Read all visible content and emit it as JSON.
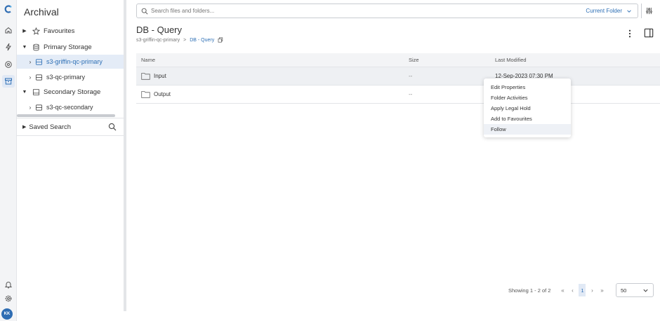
{
  "sidebar_icons": [
    "logo-icon",
    "home-icon",
    "activity-icon",
    "gauge-icon",
    "archive-icon",
    "bell-icon",
    "gear-icon"
  ],
  "user": {
    "initials": "KK"
  },
  "tree": {
    "title": "Archival",
    "favourites": "Favourites",
    "primary_storage": "Primary Storage",
    "primary_items": [
      "s3-griffin-qc-primary",
      "s3-qc-primary"
    ],
    "secondary_storage": "Secondary Storage",
    "secondary_items": [
      "s3-qc-secondary"
    ],
    "saved_search": "Saved Search"
  },
  "search": {
    "placeholder": "Search files and folders...",
    "scope": "Current Folder"
  },
  "page": {
    "title": "DB - Query",
    "breadcrumb": [
      "s3-griffin-qc-primary",
      ">",
      "DB - Query"
    ]
  },
  "table": {
    "headers": {
      "name": "Name",
      "size": "Size",
      "modified": "Last Modified"
    },
    "rows": [
      {
        "name": "Input",
        "size": "--",
        "modified": "12-Sep-2023 07:30 PM"
      },
      {
        "name": "Output",
        "size": "--",
        "modified": ""
      }
    ]
  },
  "context_menu": [
    "Edit Properties",
    "Folder Activities",
    "Apply Legal Hold",
    "Add to Favourites",
    "Follow"
  ],
  "pagination": {
    "summary": "Showing 1 - 2 of 2",
    "current_page": "1",
    "page_size": "50"
  },
  "colors": {
    "accent": "#2d6fb5",
    "selected": "#e4ecf7"
  }
}
